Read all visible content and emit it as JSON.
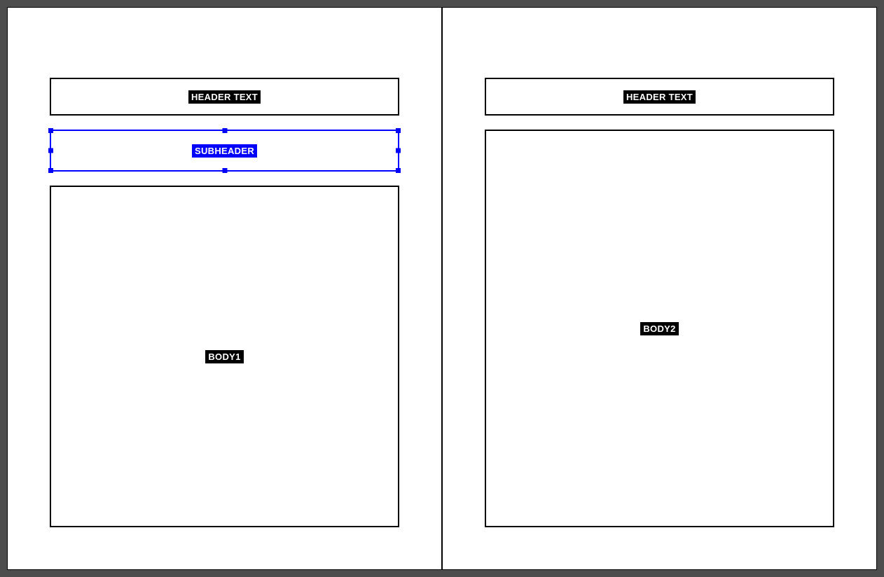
{
  "pages": [
    {
      "header": {
        "label": "HEADER TEXT",
        "selected": false
      },
      "subheader": {
        "label": "SUBHEADER",
        "selected": true
      },
      "body": {
        "label": "BODY1",
        "selected": false
      }
    },
    {
      "header": {
        "label": "HEADER TEXT",
        "selected": false
      },
      "body": {
        "label": "BODY2",
        "selected": false
      }
    }
  ],
  "colors": {
    "selection": "#0000ff",
    "frame": "#000000",
    "label_bg": "#000000",
    "label_fg": "#ffffff",
    "canvas_bg": "#4d4d4d",
    "page_bg": "#ffffff"
  }
}
